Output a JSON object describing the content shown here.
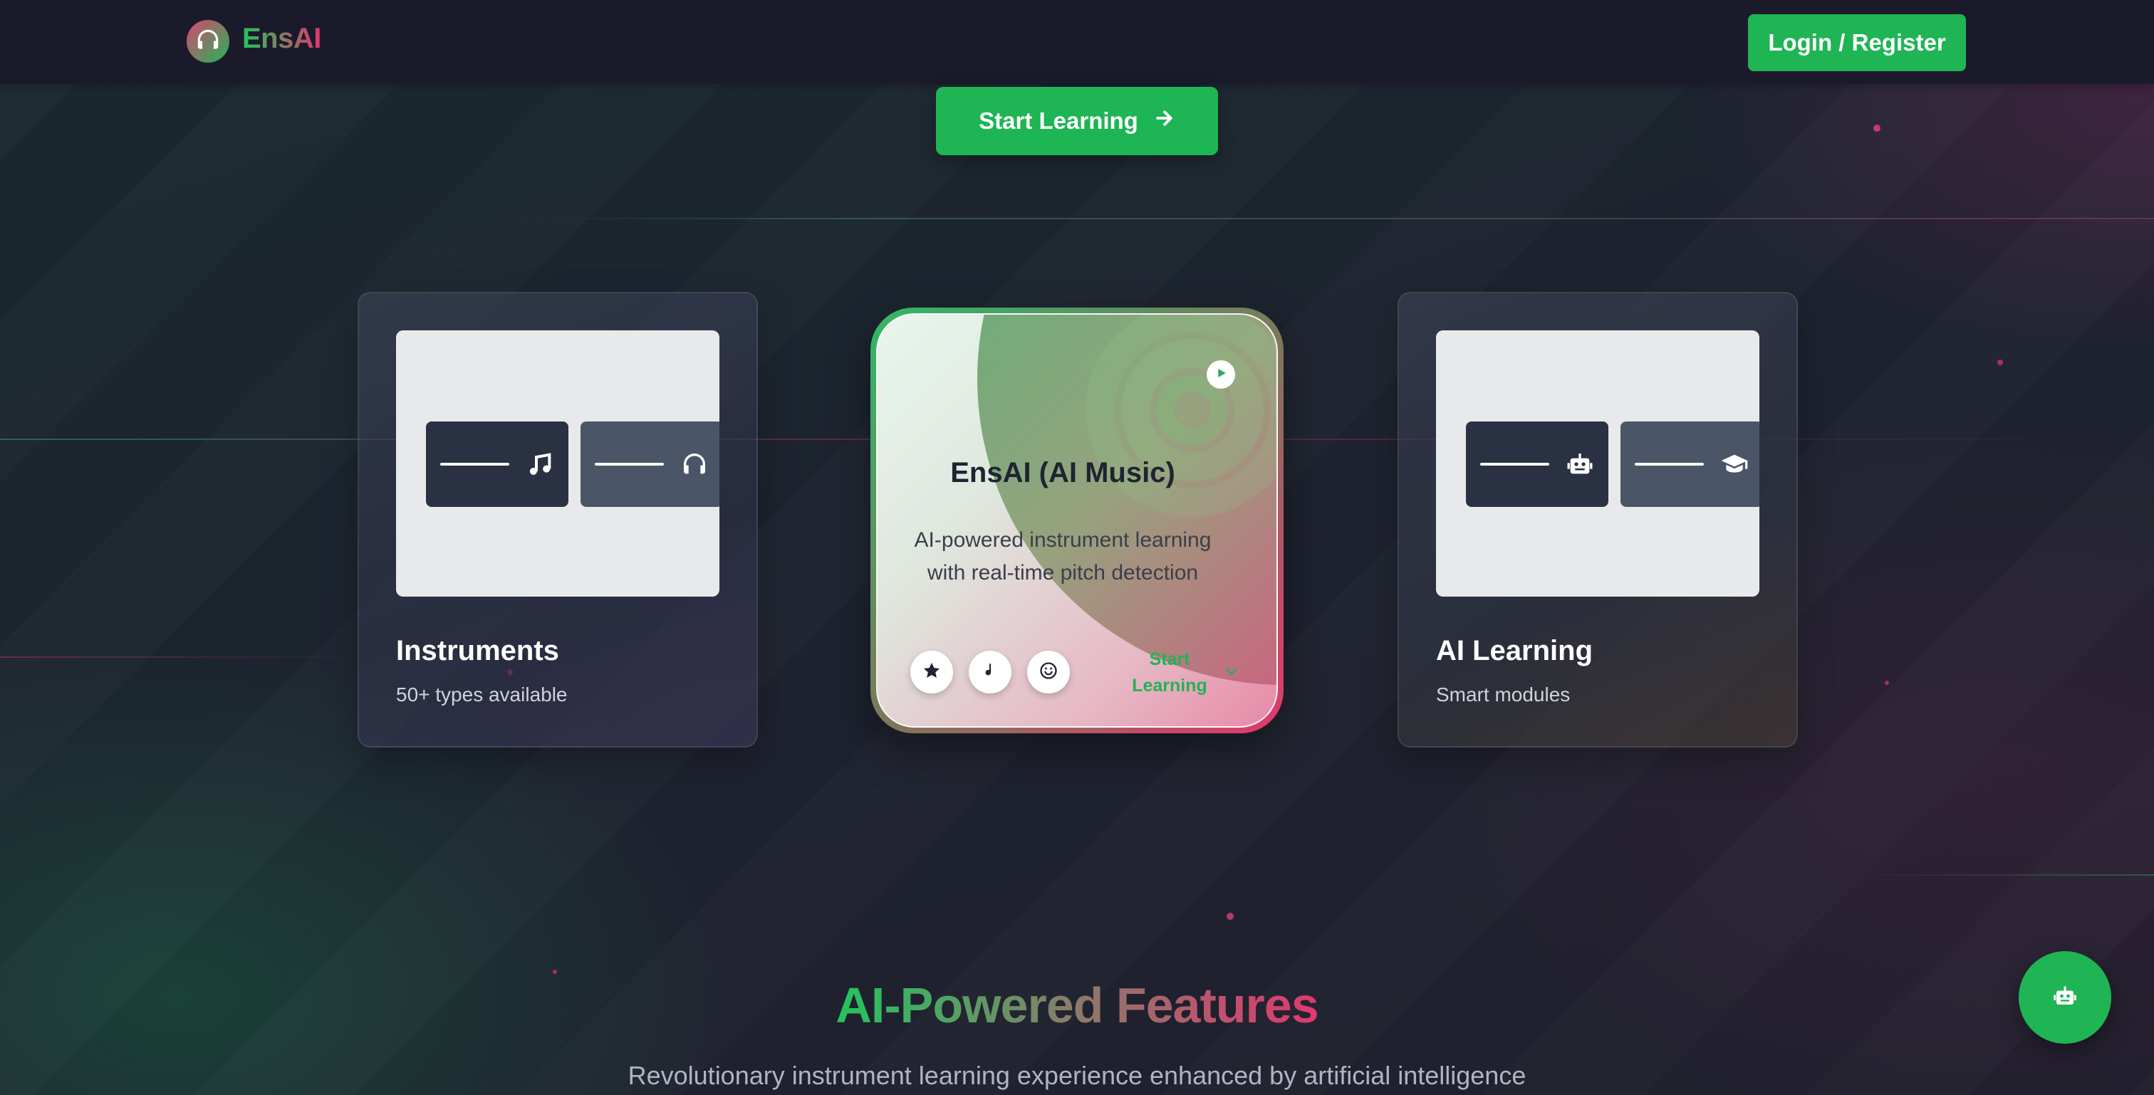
{
  "brand": {
    "name": "EnsAI"
  },
  "nav": {
    "login_label": "Login / Register"
  },
  "hero": {
    "start_label": "Start Learning"
  },
  "cards": {
    "left": {
      "title": "Instruments",
      "subtitle": "50+ types available"
    },
    "center": {
      "title": "EnsAI (AI Music)",
      "description": "AI-powered instrument learning with real-time pitch detection",
      "cta_label": "Start Learning"
    },
    "right": {
      "title": "AI Learning",
      "subtitle": "Smart modules"
    }
  },
  "features": {
    "title": "AI-Powered Features",
    "subtitle": "Revolutionary instrument learning experience enhanced by artificial intelligence"
  },
  "colors": {
    "accent_green": "#1fb554",
    "accent_pink": "#e2386e",
    "navbar": "#1b1a2b"
  },
  "icons": [
    "headphones-icon",
    "arrow-right-icon",
    "music-note-icon",
    "robot-icon",
    "graduation-cap-icon",
    "play-icon",
    "star-icon",
    "emoji-icon",
    "chevron-down-icon"
  ]
}
